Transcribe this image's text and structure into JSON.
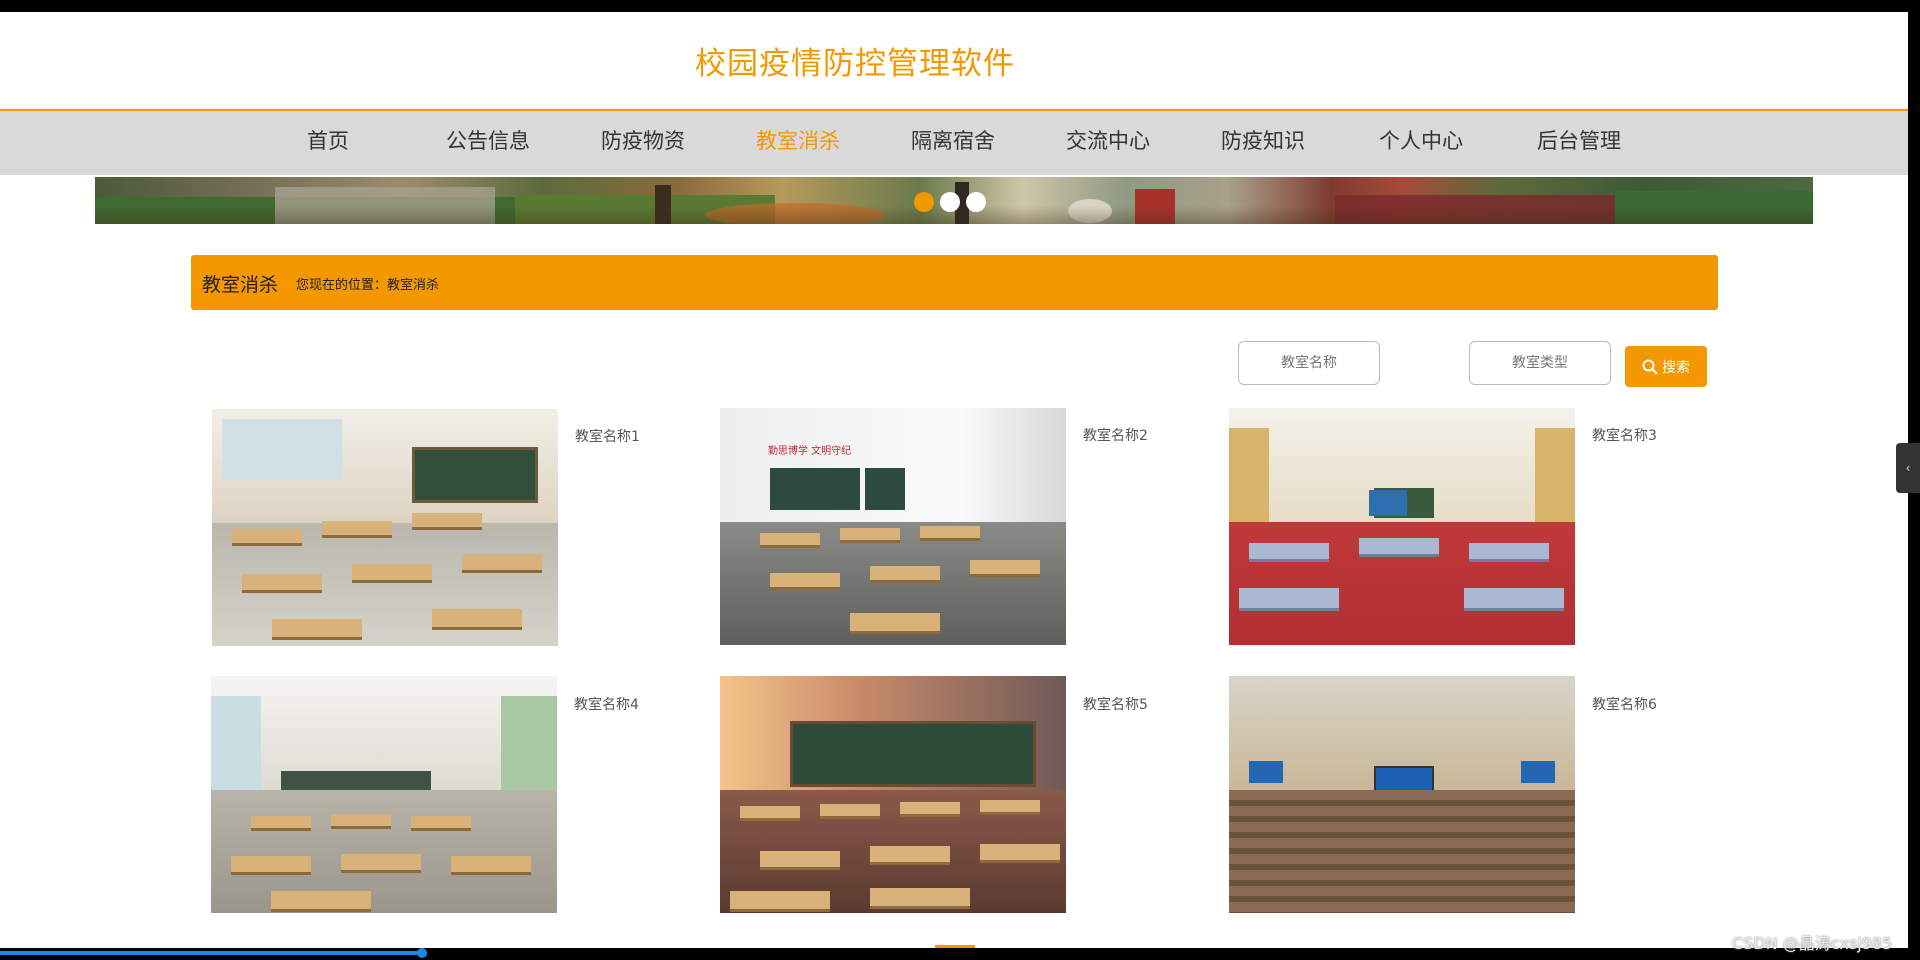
{
  "header": {
    "title": "校园疫情防控管理软件"
  },
  "nav": {
    "items": [
      "首页",
      "公告信息",
      "防疫物资",
      "教室消杀",
      "隔离宿舍",
      "交流中心",
      "防疫知识",
      "个人中心",
      "后台管理"
    ],
    "active_index": 3
  },
  "carousel": {
    "slide_count": 3,
    "active_index": 0
  },
  "breadcrumb": {
    "title": "教室消杀",
    "location": "您现在的位置：教室消杀"
  },
  "search": {
    "name_placeholder": "教室名称",
    "type_placeholder": "教室类型",
    "button_label": "搜索",
    "icon": "search-icon"
  },
  "classrooms": [
    {
      "name": "教室名称1"
    },
    {
      "name": "教室名称2",
      "banner_text": "勤思博学 文明守纪"
    },
    {
      "name": "教室名称3"
    },
    {
      "name": "教室名称4"
    },
    {
      "name": "教室名称5"
    },
    {
      "name": "教室名称6"
    }
  ],
  "sidebar_toggle": {
    "icon": "chevron-left-icon",
    "glyph": "‹"
  },
  "watermark": "CSDN @晶涛cxsj985",
  "video_progress": 0.22,
  "colors": {
    "accent": "#f39800",
    "nav_bg": "#d9d9d9",
    "progress": "#1e88e5"
  }
}
